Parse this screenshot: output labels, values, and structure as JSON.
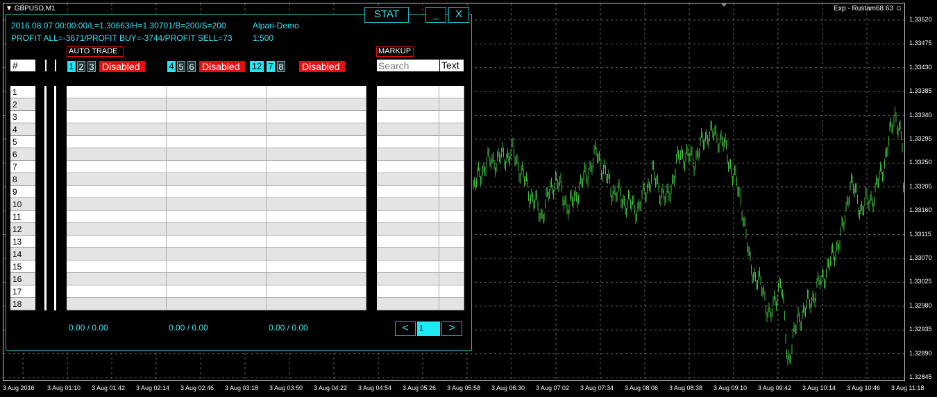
{
  "chart": {
    "symbol_title": "GBPUSD,M1",
    "expert_label": "Exp - Rustam68 63",
    "smiley_icon": "smiley-icon",
    "y_axis": [
      "1.33520",
      "1.33475",
      "1.33430",
      "1.33385",
      "1.33340",
      "1.33295",
      "1.33250",
      "1.33205",
      "1.33160",
      "1.33115",
      "1.33070",
      "1.33025",
      "1.32980",
      "1.32935",
      "1.32890",
      "1.32845"
    ],
    "x_axis": [
      "3 Aug 2016",
      "3 Aug 01:10",
      "3 Aug 01:42",
      "3 Aug 02:14",
      "3 Aug 02:46",
      "3 Aug 03:18",
      "3 Aug 03:50",
      "3 Aug 04:22",
      "3 Aug 04:54",
      "3 Aug 05:26",
      "3 Aug 05:58",
      "3 Aug 06:30",
      "3 Aug 07:02",
      "3 Aug 07:34",
      "3 Aug 08:06",
      "3 Aug 08:38",
      "3 Aug 09:10",
      "3 Aug 09:42",
      "3 Aug 10:14",
      "3 Aug 10:46",
      "3 Aug 11:18"
    ],
    "price_color": "#3fbf3f"
  },
  "panel": {
    "stat_label": "STAT",
    "minimize_label": "_",
    "close_label": "X",
    "info_line1": "2016.08.07 00:00:00/L=1.30663/H=1.30701/B=200/S=200",
    "info_broker": "Alpari-Demo",
    "info_line2": "PROFIT ALL=-3671/PROFIT BUY=-3744/PROFIT SELL=73",
    "info_leverage": "1:500",
    "auto_trade_label": "AUTO TRADE",
    "markup_label": "MARKUP",
    "hash_label": "#",
    "group1": [
      "1",
      "2",
      "3"
    ],
    "group2": [
      "4",
      "5",
      "6"
    ],
    "group3": [
      "12",
      "7",
      "8"
    ],
    "disabled_label": "Disabled",
    "search_placeholder": "Search",
    "text_label": "Text",
    "rows": [
      "1",
      "2",
      "3",
      "4",
      "5",
      "6",
      "7",
      "8",
      "9",
      "10",
      "11",
      "12",
      "13",
      "14",
      "15",
      "16",
      "17",
      "18"
    ],
    "totals": [
      "0.00 / 0.00",
      "0.00 / 0.00",
      "0.00 / 0.00"
    ],
    "prev_label": "<",
    "page_value": "1",
    "next_label": ">",
    "accent_color": "#1fb5c3",
    "alert_color": "#e01010"
  }
}
